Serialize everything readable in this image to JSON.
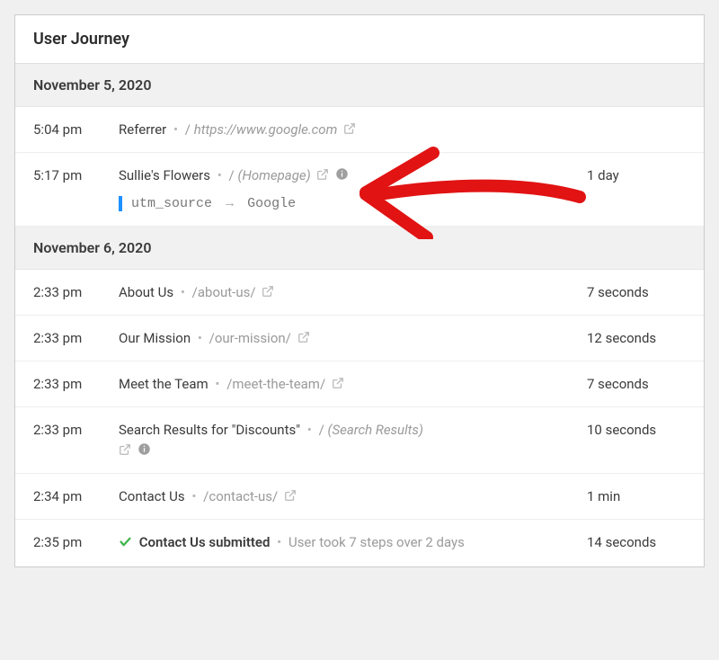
{
  "panel": {
    "title": "User Journey"
  },
  "dates": {
    "d1": "November 5, 2020",
    "d2": "November 6, 2020"
  },
  "rows": {
    "r1": {
      "time": "5:04 pm",
      "title": "Referrer",
      "path": "https://www.google.com",
      "duration": ""
    },
    "r2": {
      "time": "5:17 pm",
      "title": "Sullie's Flowers",
      "path": "(Homepage)",
      "duration": "1 day",
      "utm_key": "utm_source",
      "utm_val": "Google"
    },
    "r3": {
      "time": "2:33 pm",
      "title": "About Us",
      "path": "/about-us/",
      "duration": "7 seconds"
    },
    "r4": {
      "time": "2:33 pm",
      "title": "Our Mission",
      "path": "/our-mission/",
      "duration": "12 seconds"
    },
    "r5": {
      "time": "2:33 pm",
      "title": "Meet the Team",
      "path": "/meet-the-team/",
      "duration": "7 seconds"
    },
    "r6": {
      "time": "2:33 pm",
      "title": "Search Results for \"Discounts\"",
      "path": "(Search Results)",
      "duration": "10 seconds"
    },
    "r7": {
      "time": "2:34 pm",
      "title": "Contact Us",
      "path": "/contact-us/",
      "duration": "1 min"
    },
    "r8": {
      "time": "2:35 pm",
      "title": "Contact Us submitted",
      "note": "User took 7 steps over 2 days",
      "duration": "14 seconds"
    }
  },
  "glyphs": {
    "bullet": "•",
    "slash": "/",
    "arrow": "→"
  }
}
